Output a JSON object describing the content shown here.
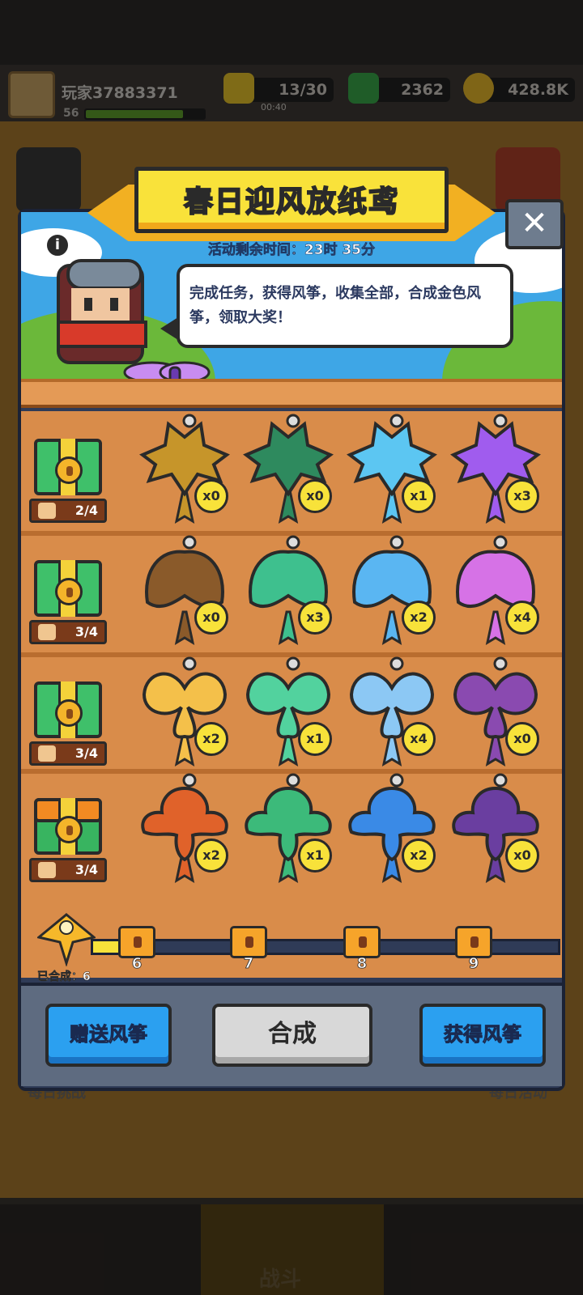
{
  "hud": {
    "player_name": "玩家37883371",
    "player_level": "56",
    "energy": "13/30",
    "energy_timer": "00:40",
    "gems": "2362",
    "gold": "428.8K",
    "xp_progress": 0.8
  },
  "event": {
    "title": "春日迎风放纸鸢",
    "time_left": "活动剩余时间：23时 35分",
    "description": "完成任务，获得风筝，收集全部，合成金色风筝，领取大奖！",
    "close_glyph": "✕",
    "info_glyph": "i"
  },
  "rows": [
    {
      "counter": "2/4",
      "chest": "green",
      "kites": [
        {
          "shape": "bat",
          "color": "#c6952a",
          "count": "x0"
        },
        {
          "shape": "bat",
          "color": "#2e8a5e",
          "count": "x0"
        },
        {
          "shape": "bat",
          "color": "#5cc6f2",
          "count": "x1"
        },
        {
          "shape": "bat",
          "color": "#a05cee",
          "count": "x3"
        }
      ]
    },
    {
      "counter": "3/4",
      "chest": "green",
      "kites": [
        {
          "shape": "moth",
          "color": "#8a5a2a",
          "count": "x0"
        },
        {
          "shape": "moth",
          "color": "#3ec08e",
          "count": "x3"
        },
        {
          "shape": "moth",
          "color": "#5ab6f2",
          "count": "x2"
        },
        {
          "shape": "moth",
          "color": "#d672e6",
          "count": "x4"
        }
      ]
    },
    {
      "counter": "3/4",
      "chest": "green",
      "kites": [
        {
          "shape": "butterfly",
          "color": "#f4c04a",
          "count": "x2"
        },
        {
          "shape": "butterfly",
          "color": "#52d29e",
          "count": "x1"
        },
        {
          "shape": "butterfly",
          "color": "#8cc8f4",
          "count": "x4"
        },
        {
          "shape": "butterfly",
          "color": "#8a4ab0",
          "count": "x0"
        }
      ]
    },
    {
      "counter": "3/4",
      "chest": "gold",
      "kites": [
        {
          "shape": "bird",
          "color": "#e0622a",
          "count": "x2"
        },
        {
          "shape": "bird",
          "color": "#3cba7a",
          "count": "x1"
        },
        {
          "shape": "bird",
          "color": "#3a8ae6",
          "count": "x2"
        },
        {
          "shape": "bird",
          "color": "#6a3ea0",
          "count": "x0"
        }
      ]
    }
  ],
  "progress": {
    "synth_label": "已合成：6",
    "milestones": [
      "6",
      "7",
      "8",
      "9"
    ],
    "fill_fraction": 0.11
  },
  "buttons": {
    "gift": "赠送风筝",
    "synthesize": "合成",
    "obtain": "获得风筝"
  },
  "background": {
    "daily_challenge": "每日挑战",
    "daily_event": "每日活动",
    "battle": "战斗"
  }
}
